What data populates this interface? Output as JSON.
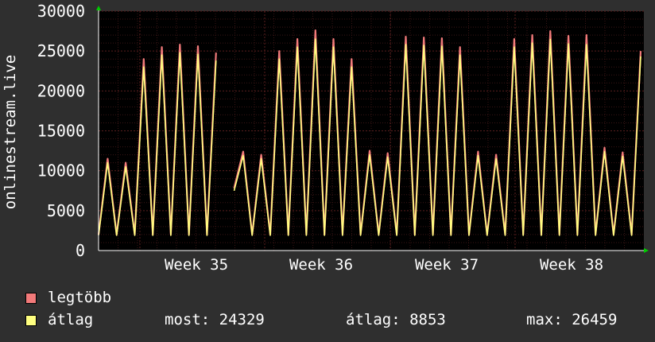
{
  "chart_data": {
    "type": "line",
    "ylabel": "onlinestream.live",
    "yticks": [
      "0",
      "5000",
      "10000",
      "15000",
      "20000",
      "25000",
      "30000"
    ],
    "ylim": [
      0,
      30000
    ],
    "xticks": [
      "Week 35",
      "Week 36",
      "Week 37",
      "Week 38"
    ],
    "grid": true,
    "colors": {
      "background": "#000000",
      "grid": "#5a1e1e",
      "max_series": "#f27a7a",
      "avg_series": "#ffff80",
      "axis_arrow": "#00cc00"
    },
    "series": [
      {
        "name": "legtöbb",
        "color": "#f27a7a",
        "values": [
          2000,
          11500,
          2000,
          11000,
          2000,
          24000,
          2000,
          25500,
          2000,
          25800,
          2000,
          25600,
          2000,
          24800,
          null,
          7800,
          12400,
          2000,
          12000,
          2000,
          25000,
          2000,
          26500,
          2000,
          27600,
          2000,
          26500,
          2000,
          24000,
          2000,
          12500,
          2000,
          12200,
          2000,
          26800,
          2000,
          26700,
          2000,
          26600,
          2000,
          25500,
          2000,
          12400,
          2000,
          12000,
          2000,
          26500,
          2000,
          27000,
          2000,
          27500,
          2000,
          26900,
          2000,
          27000,
          2000,
          12900,
          2000,
          12300,
          2000,
          25000
        ]
      },
      {
        "name": "átlag",
        "color": "#ffff80",
        "values": [
          1900,
          11000,
          1900,
          10500,
          1900,
          23000,
          1900,
          24500,
          1900,
          24800,
          1900,
          24600,
          1900,
          23800,
          null,
          7500,
          11900,
          1900,
          11500,
          1900,
          24000,
          1900,
          25500,
          1900,
          26500,
          1900,
          25500,
          1900,
          23000,
          1900,
          12000,
          1900,
          11700,
          1900,
          25800,
          1900,
          25700,
          1900,
          25600,
          1900,
          24500,
          1900,
          11900,
          1900,
          11500,
          1900,
          25500,
          1900,
          26000,
          1900,
          26459,
          1900,
          25900,
          1900,
          25800,
          1900,
          12400,
          1900,
          11800,
          1900,
          24329
        ]
      }
    ]
  },
  "legend": {
    "max_label": "legtöbb",
    "avg_label": "átlag",
    "max_color": "#f27a7a",
    "avg_color": "#ffff80",
    "now_text": "most: 24329",
    "avg_text": "átlag: 8853",
    "max_text": "max: 26459"
  }
}
